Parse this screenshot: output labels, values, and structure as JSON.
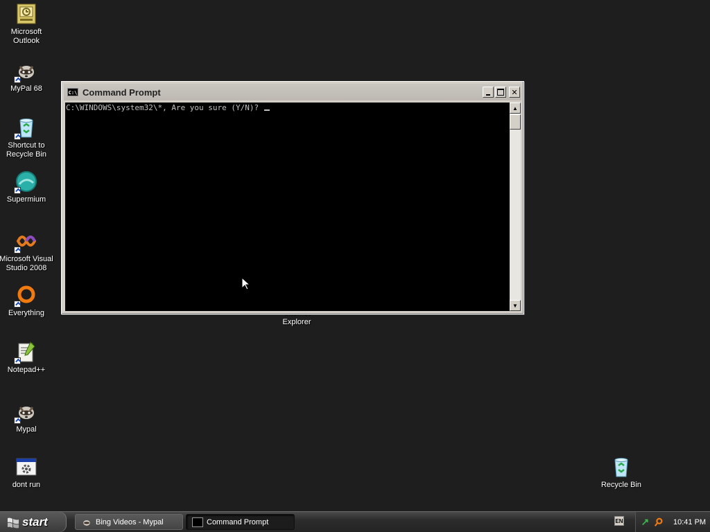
{
  "desktop": {
    "icons": [
      {
        "label": "Microsoft Outlook"
      },
      {
        "label": "MyPal 68"
      },
      {
        "label": "Shortcut to Recycle Bin"
      },
      {
        "label": "Supermium"
      },
      {
        "label": "Microsoft Visual Studio 2008"
      },
      {
        "label": "Everything"
      },
      {
        "label": "Notepad++"
      },
      {
        "label": "Mypal"
      },
      {
        "label": "dont run"
      },
      {
        "label": "Internet Explorer"
      },
      {
        "label": "Recycle Bin"
      }
    ]
  },
  "window": {
    "title": "Command Prompt",
    "icon_text": "C:\\",
    "console_text": "C:\\WINDOWS\\system32\\*, Are you sure (Y/N)? "
  },
  "taskbar": {
    "start_label": "start",
    "tasks": [
      {
        "label": "Bing Videos - Mypal"
      },
      {
        "label": "Command Prompt"
      }
    ],
    "language": "EN",
    "clock": "10:41 PM"
  }
}
